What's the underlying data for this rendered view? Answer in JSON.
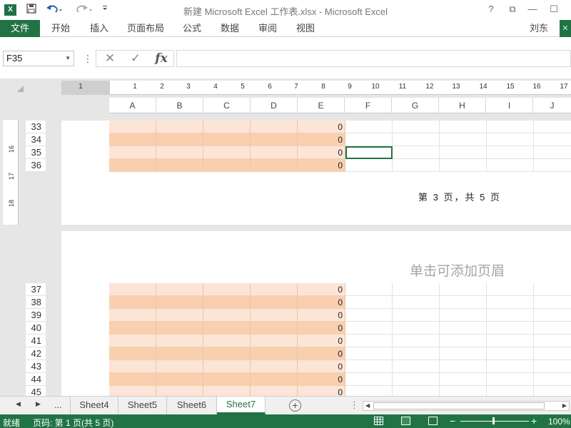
{
  "titlebar": {
    "logo": "X",
    "title": "新建 Microsoft Excel 工作表.xlsx - Microsoft Excel",
    "help": "?",
    "restore": "⧉",
    "minimize": "—",
    "maximize": "☐"
  },
  "ribbon": {
    "file": "文件",
    "tabs": [
      "开始",
      "插入",
      "页面布局",
      "公式",
      "数据",
      "审阅",
      "视图"
    ],
    "user": "刘东"
  },
  "formula_bar": {
    "name_box": "F35",
    "cancel": "✕",
    "enter": "✓",
    "fx": "fx",
    "value": ""
  },
  "ruler": {
    "margin_label": "1",
    "numbers": [
      "1",
      "2",
      "3",
      "4",
      "5",
      "6",
      "7",
      "8",
      "9",
      "10",
      "11",
      "12",
      "13",
      "14",
      "15",
      "16",
      "17"
    ],
    "vertical": [
      "16",
      "17",
      "18"
    ]
  },
  "columns": [
    "A",
    "B",
    "C",
    "D",
    "E",
    "F",
    "G",
    "H",
    "I",
    "J"
  ],
  "page1": {
    "rows": [
      {
        "num": "33",
        "value": "0"
      },
      {
        "num": "34",
        "value": "0"
      },
      {
        "num": "35",
        "value": "0"
      },
      {
        "num": "36",
        "value": "0"
      }
    ],
    "footer": "第 3 页，共 5 页"
  },
  "page2": {
    "header_placeholder": "单击可添加页眉",
    "rows": [
      {
        "num": "37",
        "value": "0"
      },
      {
        "num": "38",
        "value": "0"
      },
      {
        "num": "39",
        "value": "0"
      },
      {
        "num": "40",
        "value": "0"
      },
      {
        "num": "41",
        "value": "0"
      },
      {
        "num": "42",
        "value": "0"
      },
      {
        "num": "43",
        "value": "0"
      },
      {
        "num": "44",
        "value": "0"
      },
      {
        "num": "45",
        "value": "0"
      }
    ]
  },
  "sheet_tabs": {
    "more": "...",
    "tabs": [
      "Sheet4",
      "Sheet5",
      "Sheet6",
      "Sheet7"
    ],
    "active": "Sheet7",
    "add": "+"
  },
  "statusbar": {
    "ready": "就绪",
    "page_info": "页码: 第 1 页(共 5 页)",
    "zoom_minus": "−",
    "zoom_plus": "+",
    "zoom": "100%"
  },
  "colors": {
    "accent": "#217346",
    "band_light": "#fce4d6",
    "band_dark": "#f9cfae"
  }
}
